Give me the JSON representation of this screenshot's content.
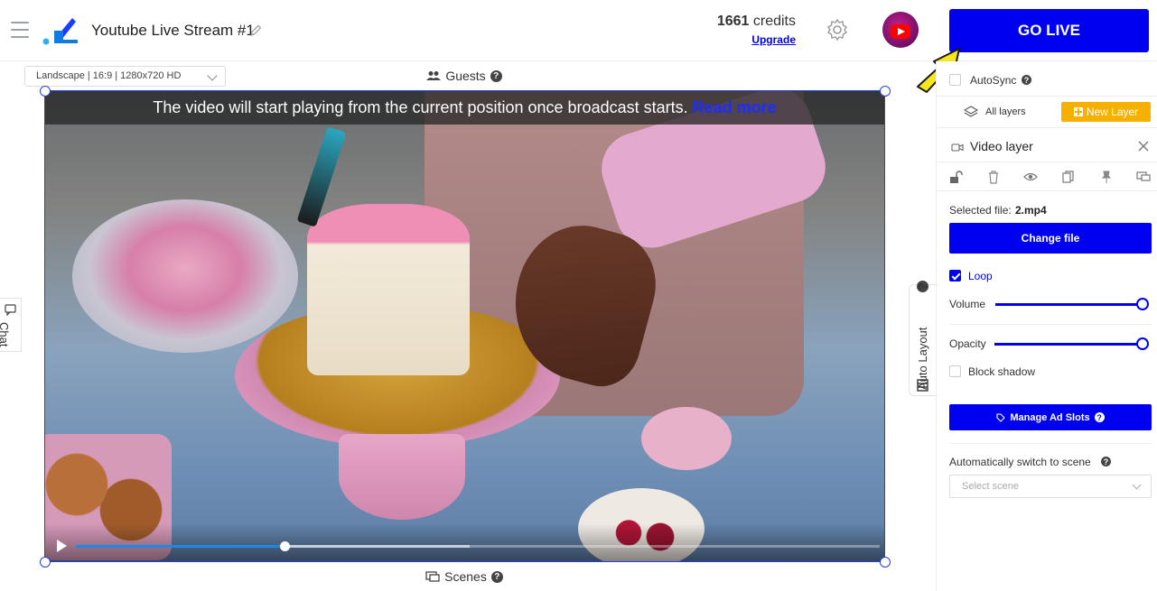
{
  "header": {
    "stream_title": "Youtube Live Stream #1",
    "credits_value": "1661",
    "credits_label": "credits",
    "upgrade_label": "Upgrade",
    "go_live_label": "GO LIVE"
  },
  "stage": {
    "resolution_select": "Landscape | 16:9 | 1280x720 HD",
    "guests_label": "Guests",
    "scenes_label": "Scenes",
    "notice_text": "The video will start playing from the current position once broadcast starts.",
    "notice_link": "Read more",
    "playback_progress": 0.26,
    "buffer_progress": 0.49
  },
  "side_tabs": {
    "chat_label": "Chat",
    "auto_layout_label": "Auto Layout"
  },
  "panel": {
    "autosync_label": "AutoSync",
    "all_layers_label": "All layers",
    "new_layer_label": "New Layer",
    "layer_title": "Video layer",
    "selected_file_label": "Selected file:",
    "selected_file_name": "2.mp4",
    "change_file_label": "Change file",
    "loop_label": "Loop",
    "loop_checked": true,
    "volume_label": "Volume",
    "volume_level": 1.0,
    "opacity_label": "Opacity",
    "opacity_level": 1.0,
    "block_shadow_label": "Block shadow",
    "manage_ad_slots_label": "Manage Ad Slots",
    "auto_switch_label": "Automatically switch to scene",
    "select_scene_placeholder": "Select scene"
  },
  "colors": {
    "accent_blue": "#0000f0",
    "new_layer_orange": "#f6b000",
    "progress_blue": "#1e88e5"
  }
}
